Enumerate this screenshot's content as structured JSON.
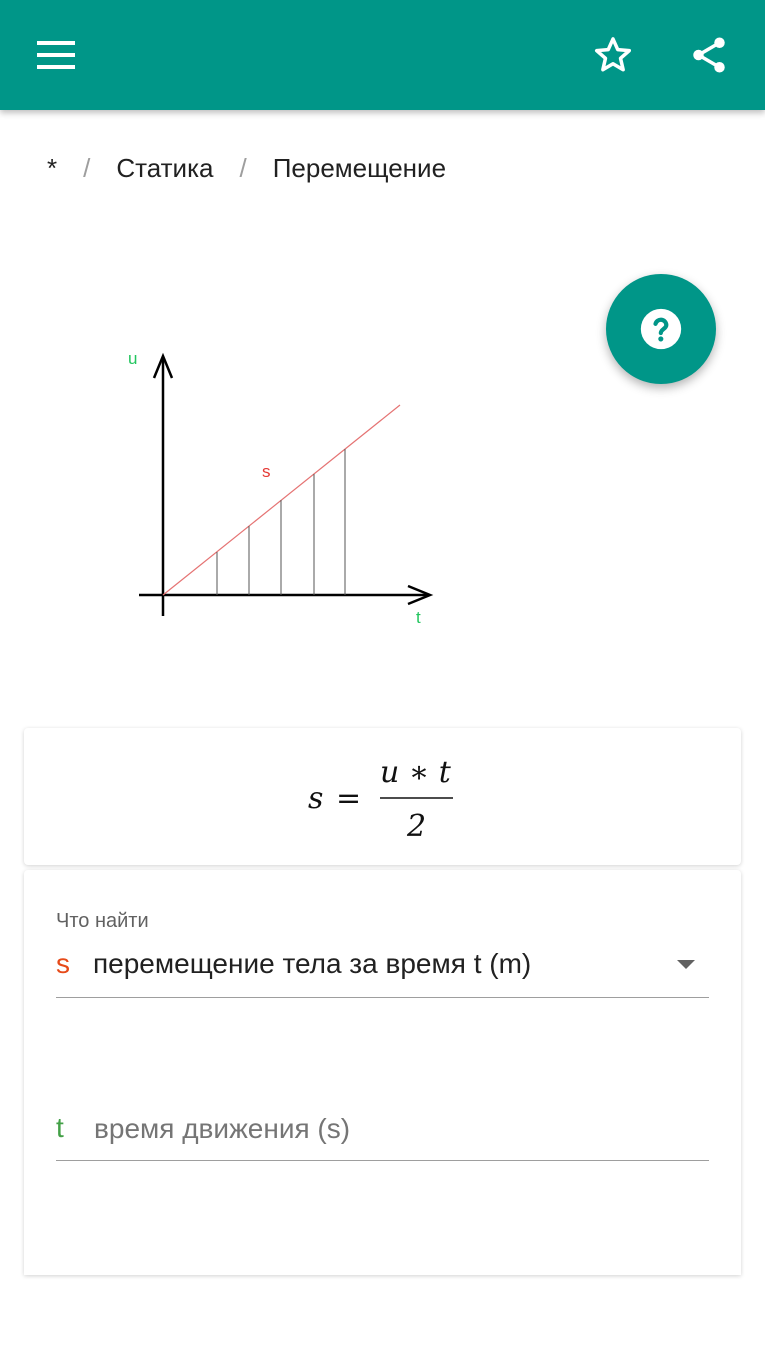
{
  "colors": {
    "primary": "#009688",
    "result_symbol": "#e64a19",
    "input_symbol": "#43a047",
    "graph_line": "#e57373",
    "axis_label": "#2e7d32"
  },
  "appbar": {
    "menu_icon": "menu-icon",
    "star_icon": "star-outline-icon",
    "share_icon": "share-icon"
  },
  "breadcrumb": {
    "root": "*",
    "category": "Статика",
    "current": "Перемещение"
  },
  "diagram": {
    "y_axis_label": "u",
    "x_axis_label": "t",
    "area_label": "s"
  },
  "formula": {
    "lhs": "s",
    "equals": "=",
    "numerator": "u ∗ t",
    "denominator": "2"
  },
  "form": {
    "find_label": "Что найти",
    "result": {
      "symbol": "s",
      "value": "перемещение тела за время t (m)"
    },
    "inputs": [
      {
        "symbol": "t",
        "placeholder": "время движения (s)",
        "value": ""
      }
    ]
  },
  "fab_icon": "help-icon"
}
